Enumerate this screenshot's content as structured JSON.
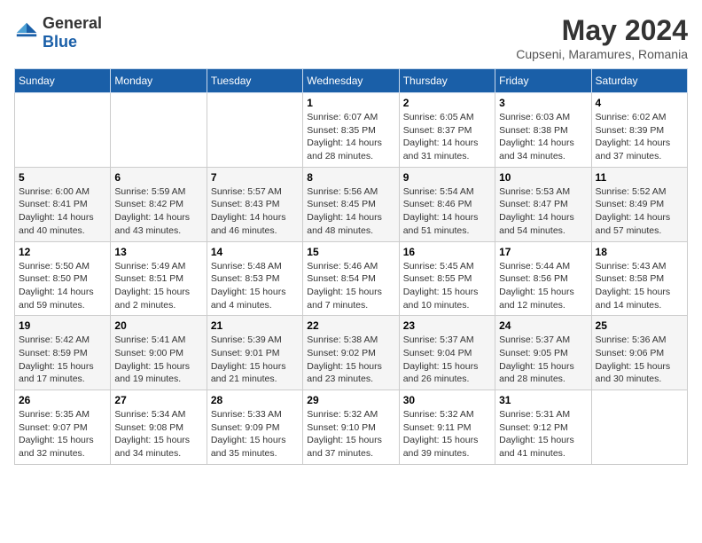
{
  "logo": {
    "general": "General",
    "blue": "Blue"
  },
  "title": {
    "month_year": "May 2024",
    "location": "Cupseni, Maramures, Romania"
  },
  "weekdays": [
    "Sunday",
    "Monday",
    "Tuesday",
    "Wednesday",
    "Thursday",
    "Friday",
    "Saturday"
  ],
  "weeks": [
    [
      {
        "day": "",
        "info": ""
      },
      {
        "day": "",
        "info": ""
      },
      {
        "day": "",
        "info": ""
      },
      {
        "day": "1",
        "info": "Sunrise: 6:07 AM\nSunset: 8:35 PM\nDaylight: 14 hours\nand 28 minutes."
      },
      {
        "day": "2",
        "info": "Sunrise: 6:05 AM\nSunset: 8:37 PM\nDaylight: 14 hours\nand 31 minutes."
      },
      {
        "day": "3",
        "info": "Sunrise: 6:03 AM\nSunset: 8:38 PM\nDaylight: 14 hours\nand 34 minutes."
      },
      {
        "day": "4",
        "info": "Sunrise: 6:02 AM\nSunset: 8:39 PM\nDaylight: 14 hours\nand 37 minutes."
      }
    ],
    [
      {
        "day": "5",
        "info": "Sunrise: 6:00 AM\nSunset: 8:41 PM\nDaylight: 14 hours\nand 40 minutes."
      },
      {
        "day": "6",
        "info": "Sunrise: 5:59 AM\nSunset: 8:42 PM\nDaylight: 14 hours\nand 43 minutes."
      },
      {
        "day": "7",
        "info": "Sunrise: 5:57 AM\nSunset: 8:43 PM\nDaylight: 14 hours\nand 46 minutes."
      },
      {
        "day": "8",
        "info": "Sunrise: 5:56 AM\nSunset: 8:45 PM\nDaylight: 14 hours\nand 48 minutes."
      },
      {
        "day": "9",
        "info": "Sunrise: 5:54 AM\nSunset: 8:46 PM\nDaylight: 14 hours\nand 51 minutes."
      },
      {
        "day": "10",
        "info": "Sunrise: 5:53 AM\nSunset: 8:47 PM\nDaylight: 14 hours\nand 54 minutes."
      },
      {
        "day": "11",
        "info": "Sunrise: 5:52 AM\nSunset: 8:49 PM\nDaylight: 14 hours\nand 57 minutes."
      }
    ],
    [
      {
        "day": "12",
        "info": "Sunrise: 5:50 AM\nSunset: 8:50 PM\nDaylight: 14 hours\nand 59 minutes."
      },
      {
        "day": "13",
        "info": "Sunrise: 5:49 AM\nSunset: 8:51 PM\nDaylight: 15 hours\nand 2 minutes."
      },
      {
        "day": "14",
        "info": "Sunrise: 5:48 AM\nSunset: 8:53 PM\nDaylight: 15 hours\nand 4 minutes."
      },
      {
        "day": "15",
        "info": "Sunrise: 5:46 AM\nSunset: 8:54 PM\nDaylight: 15 hours\nand 7 minutes."
      },
      {
        "day": "16",
        "info": "Sunrise: 5:45 AM\nSunset: 8:55 PM\nDaylight: 15 hours\nand 10 minutes."
      },
      {
        "day": "17",
        "info": "Sunrise: 5:44 AM\nSunset: 8:56 PM\nDaylight: 15 hours\nand 12 minutes."
      },
      {
        "day": "18",
        "info": "Sunrise: 5:43 AM\nSunset: 8:58 PM\nDaylight: 15 hours\nand 14 minutes."
      }
    ],
    [
      {
        "day": "19",
        "info": "Sunrise: 5:42 AM\nSunset: 8:59 PM\nDaylight: 15 hours\nand 17 minutes."
      },
      {
        "day": "20",
        "info": "Sunrise: 5:41 AM\nSunset: 9:00 PM\nDaylight: 15 hours\nand 19 minutes."
      },
      {
        "day": "21",
        "info": "Sunrise: 5:39 AM\nSunset: 9:01 PM\nDaylight: 15 hours\nand 21 minutes."
      },
      {
        "day": "22",
        "info": "Sunrise: 5:38 AM\nSunset: 9:02 PM\nDaylight: 15 hours\nand 23 minutes."
      },
      {
        "day": "23",
        "info": "Sunrise: 5:37 AM\nSunset: 9:04 PM\nDaylight: 15 hours\nand 26 minutes."
      },
      {
        "day": "24",
        "info": "Sunrise: 5:37 AM\nSunset: 9:05 PM\nDaylight: 15 hours\nand 28 minutes."
      },
      {
        "day": "25",
        "info": "Sunrise: 5:36 AM\nSunset: 9:06 PM\nDaylight: 15 hours\nand 30 minutes."
      }
    ],
    [
      {
        "day": "26",
        "info": "Sunrise: 5:35 AM\nSunset: 9:07 PM\nDaylight: 15 hours\nand 32 minutes."
      },
      {
        "day": "27",
        "info": "Sunrise: 5:34 AM\nSunset: 9:08 PM\nDaylight: 15 hours\nand 34 minutes."
      },
      {
        "day": "28",
        "info": "Sunrise: 5:33 AM\nSunset: 9:09 PM\nDaylight: 15 hours\nand 35 minutes."
      },
      {
        "day": "29",
        "info": "Sunrise: 5:32 AM\nSunset: 9:10 PM\nDaylight: 15 hours\nand 37 minutes."
      },
      {
        "day": "30",
        "info": "Sunrise: 5:32 AM\nSunset: 9:11 PM\nDaylight: 15 hours\nand 39 minutes."
      },
      {
        "day": "31",
        "info": "Sunrise: 5:31 AM\nSunset: 9:12 PM\nDaylight: 15 hours\nand 41 minutes."
      },
      {
        "day": "",
        "info": ""
      }
    ]
  ]
}
